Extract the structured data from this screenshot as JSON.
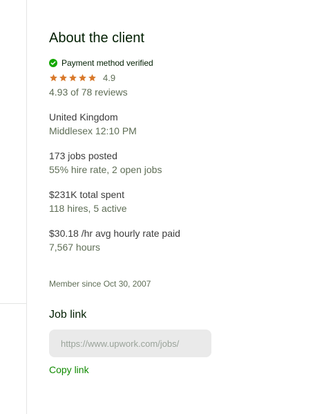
{
  "about": {
    "title": "About the client",
    "payment_verified": "Payment method verified",
    "rating_value": "4.9",
    "rating_stars": 5,
    "reviews_text": "4.93 of 78 reviews",
    "location_country": "United Kingdom",
    "location_detail": "Middlesex 12:10 PM",
    "jobs_posted": "173 jobs posted",
    "hire_rate": "55% hire rate, 2 open jobs",
    "total_spent": "$231K total spent",
    "hires": "118 hires, 5 active",
    "avg_rate": "$30.18 /hr avg hourly rate paid",
    "hours": "7,567 hours",
    "member_since": "Member since Oct 30, 2007"
  },
  "job_link": {
    "title": "Job link",
    "url_value": "https://www.upwork.com/jobs/",
    "copy_label": "Copy link"
  },
  "colors": {
    "verified_green": "#14a800",
    "star_orange": "#d8792b",
    "link_green": "#108a00"
  },
  "icons": {
    "verified": "check-circle-icon",
    "star": "star-icon"
  }
}
